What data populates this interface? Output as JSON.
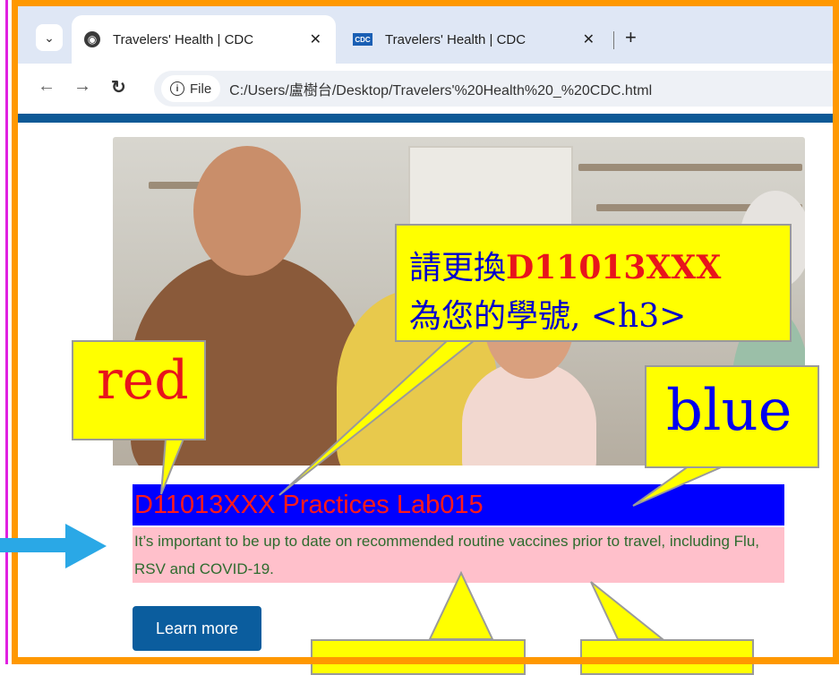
{
  "browser": {
    "tabs": [
      {
        "title": "Travelers' Health | CDC",
        "active": true
      },
      {
        "title": "Travelers' Health | CDC",
        "active": false
      }
    ],
    "new_tab": "+",
    "omnibox": {
      "chip": "File",
      "url": "C:/Users/盧樹台/Desktop/Travelers'%20Health%20_%20CDC.html"
    }
  },
  "page": {
    "heading": "D11013XXX Practices Lab015",
    "description": "It’s important to be up to date on recommended routine vaccines prior to travel, including Flu, RSV and COVID-19.",
    "learn_more": "Learn more"
  },
  "annotations": {
    "red_label": "red",
    "blue_label": "blue",
    "note_line1_prefix": "請更換",
    "note_line1_highlight": "D11013XXX",
    "note_line2": "為您的學號, <h3>"
  },
  "colors": {
    "frame": "#ff9800",
    "heading_bg": "#0000ff",
    "heading_text": "#ff1a1a",
    "desc_bg": "#ffc0cb",
    "desc_text": "#2e6b2e",
    "callout": "#ffff00",
    "arrow": "#2aa8e6"
  }
}
